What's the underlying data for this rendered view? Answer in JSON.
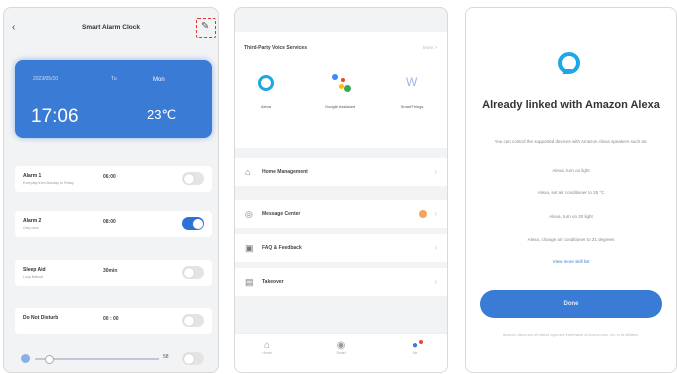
{
  "phone1": {
    "header": {
      "back_icon": "back-arrow-icon",
      "title": "Smart Alarm Clock",
      "edit_icon": "edit-pencil-icon"
    },
    "card": {
      "date_left": "2023/05/10",
      "date_mid": "Tu",
      "date_right": "Mon",
      "time": "17:06",
      "temperature": "23℃"
    },
    "rows": [
      {
        "label": "Alarm 1",
        "sub": "Everyday from Monday to Friday",
        "value": "06:00",
        "on": false
      },
      {
        "label": "Alarm 2",
        "sub": "Only once",
        "value": "08:00",
        "on": true
      },
      {
        "label": "Sleep Aid",
        "sub": "Loop Natural",
        "value": "30min",
        "on": false
      },
      {
        "label": "Do Not Disturb",
        "sub": "",
        "value": "00 : 00",
        "on": false
      }
    ],
    "brightness": {
      "value": "58",
      "level": 0.08,
      "on": false
    }
  },
  "phone2": {
    "services_header": "Third-Party Voice Services",
    "services_more": "More >",
    "services": [
      {
        "name": "Alexa",
        "icon": "alexa-icon"
      },
      {
        "name": "Google Assistant",
        "icon": "google-assistant-icon"
      },
      {
        "name": "SmartThings",
        "icon": "smartthings-icon"
      }
    ],
    "menu": [
      {
        "label": "Home Management",
        "icon": "home-icon",
        "badge": false
      },
      {
        "label": "Message Center",
        "icon": "message-icon",
        "badge": true
      },
      {
        "label": "FAQ & Feedback",
        "icon": "faq-icon",
        "badge": false
      },
      {
        "label": "Takeover",
        "icon": "takeover-icon",
        "badge": false
      }
    ],
    "tabs": [
      {
        "label": "Home",
        "icon": "home-tab-icon",
        "active": false
      },
      {
        "label": "Smart",
        "icon": "smart-tab-icon",
        "active": false
      },
      {
        "label": "Me",
        "icon": "me-tab-icon",
        "active": true
      }
    ]
  },
  "phone3": {
    "title": "Already linked with Amazon Alexa",
    "description": "You can control the supported devices with Amazon Alexa speakers such as:",
    "examples": [
      "Alexa, turn on light",
      "Alexa, set air conditioner to 25 °C",
      "Alexa, turn on 20 light",
      "Alexa, change air conditioner to 21 degrees"
    ],
    "link": "View more skill list",
    "button": "Done",
    "footer": "Amazon, Alexa and all related logos are trademarks of Amazon.com, Inc. or its affiliates."
  }
}
